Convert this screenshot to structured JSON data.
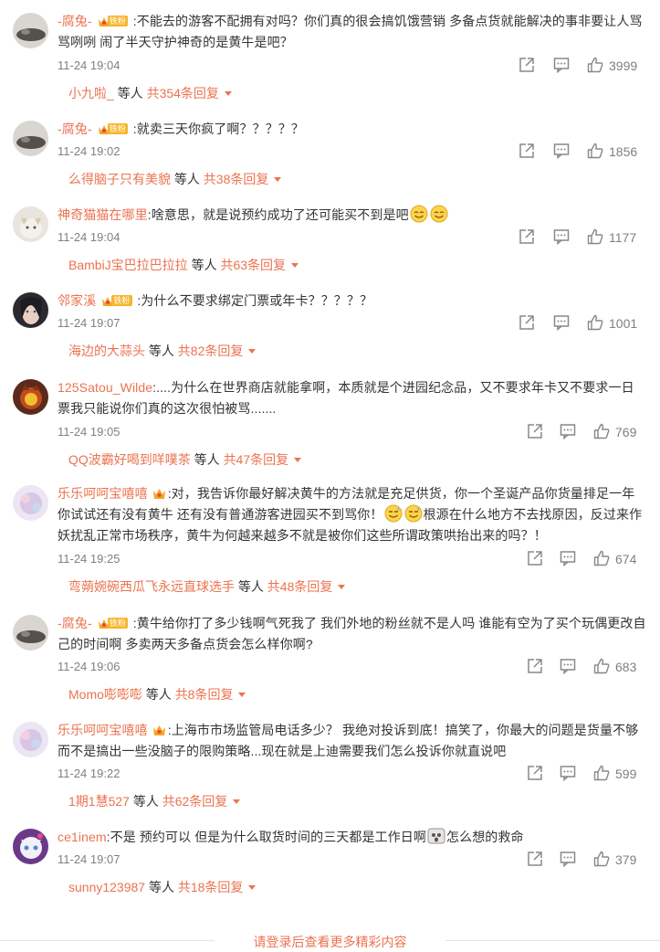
{
  "comments": [
    {
      "user": "-腐兔-",
      "fan_badge": "铁粉",
      "text": ":不能去的游客不配拥有对吗？你们真的很会搞饥饿营销 多备点货就能解决的事非要让人骂骂咧咧 闹了半天守护神奇的是黄牛是吧？",
      "time": "11-24 19:04",
      "likes": "3999",
      "reply_user": "小九啦_",
      "reply_mid": " 等人 ",
      "reply_count": "共354条回复"
    },
    {
      "user": "-腐兔-",
      "fan_badge": "铁粉",
      "text": ":就卖三天你疯了啊？？？？？",
      "time": "11-24 19:02",
      "likes": "1856",
      "reply_user": "么得脑子只有美貌",
      "reply_mid": " 等人 ",
      "reply_count": "共38条回复"
    },
    {
      "user": "神奇猫猫在哪里",
      "text": ":啥意思，就是说预约成功了还可能买不到是吧",
      "time": "11-24 19:04",
      "likes": "1177",
      "reply_user": "BambiJ宝巴拉巴拉拉",
      "reply_mid": " 等人 ",
      "reply_count": "共63条回复"
    },
    {
      "user": "邻家溪",
      "fan_badge": "铁粉",
      "text": ":为什么不要求绑定门票或年卡？？？？？",
      "time": "11-24 19:07",
      "likes": "1001",
      "reply_user": "海边的大蒜头",
      "reply_mid": " 等人 ",
      "reply_count": "共82条回复"
    },
    {
      "user": "125Satou_Wilde",
      "text": ":....为什么在世界商店就能拿啊，本质就是个进园纪念品，又不要求年卡又不要求一日票我只能说你们真的这次很怕被骂.......",
      "time": "11-24 19:05",
      "likes": "769",
      "reply_user": "QQ波霸好喝到咩噗茶",
      "reply_mid": " 等人 ",
      "reply_count": "共47条回复"
    },
    {
      "user": "乐乐呵呵宝嘻嘻",
      "text_a": ":对，我告诉你最好解决黄牛的方法就是充足供货，你一个圣诞产品你货量排足一年你试试还有没有黄牛 还有没有普通游客进园买不到骂你！",
      "text_b": "根源在什么地方不去找原因，反过来作妖扰乱正常市场秩序，黄牛为何越来越多不就是被你们这些所谓政策哄抬出来的吗？！",
      "time": "11-24 19:25",
      "likes": "674",
      "reply_user": "弯蒴婉碗西瓜飞永远直球选手",
      "reply_mid": " 等人 ",
      "reply_count": "共48条回复"
    },
    {
      "user": "-腐兔-",
      "fan_badge": "铁粉",
      "text": ":黄牛给你打了多少钱啊气死我了 我们外地的粉丝就不是人吗 谁能有空为了买个玩偶更改自己的时间啊 多卖两天多备点货会怎么样你啊?",
      "time": "11-24 19:06",
      "likes": "683",
      "reply_user": "Momo嘭嘭嘭",
      "reply_mid": " 等人 ",
      "reply_count": "共8条回复"
    },
    {
      "user": "乐乐呵呵宝嘻嘻",
      "text": ":上海市市场监管局电话多少？ 我绝对投诉到底！搞笑了，你最大的问题是货量不够而不是搞出一些没脑子的限购策略...现在就是上迪需要我们怎么投诉你就直说吧",
      "time": "11-24 19:22",
      "likes": "599",
      "reply_user": "1期1慧527",
      "reply_mid": " 等人 ",
      "reply_count": "共62条回复"
    },
    {
      "user": "ce1inem",
      "text_a": ":不是 预约可以 但是为什么取货时间的三天都是工作日啊",
      "text_b": "怎么想的救命",
      "time": "11-24 19:07",
      "likes": "379",
      "reply_user": "sunny123987",
      "reply_mid": " 等人 ",
      "reply_count": "共18条回复"
    }
  ],
  "footer": {
    "more_label": "请登录后查看更多精彩内容"
  },
  "icons": {
    "share": "share-icon",
    "comment": "comment-icon",
    "like": "thumbs-up-icon"
  },
  "colors": {
    "accent": "#eb7350",
    "muted": "#808080",
    "badge": "#f7b52a"
  }
}
